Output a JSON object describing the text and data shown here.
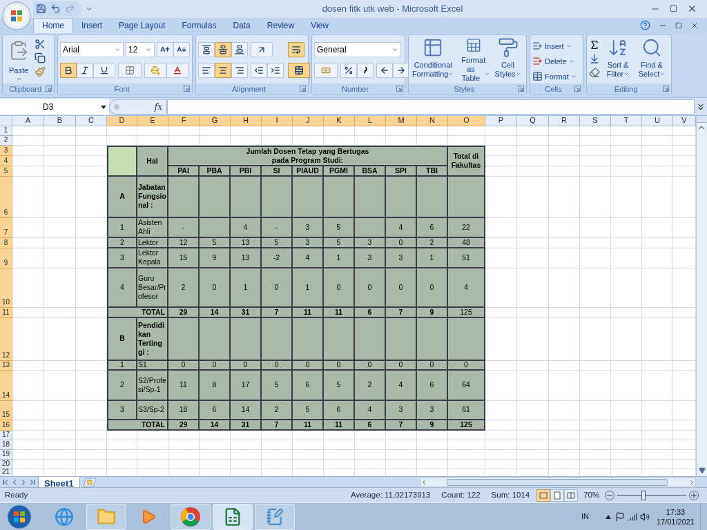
{
  "window": {
    "title": "dosen fitk utk web - Microsoft Excel"
  },
  "ribbon_tabs": [
    {
      "label": "Home",
      "selected": true
    },
    {
      "label": "Insert",
      "selected": false
    },
    {
      "label": "Page Layout",
      "selected": false
    },
    {
      "label": "Formulas",
      "selected": false
    },
    {
      "label": "Data",
      "selected": false
    },
    {
      "label": "Review",
      "selected": false
    },
    {
      "label": "View",
      "selected": false
    }
  ],
  "ribbon": {
    "clipboard": {
      "label": "Clipboard",
      "paste": "Paste"
    },
    "font": {
      "label": "Font",
      "name": "Arial",
      "size": "12",
      "bold": true,
      "italic": false,
      "underline": false
    },
    "alignment": {
      "label": "Alignment",
      "vertical": [
        {
          "kind": "top",
          "pressed": false
        },
        {
          "kind": "middle",
          "pressed": true
        },
        {
          "kind": "bottom",
          "pressed": false
        }
      ],
      "horizontal": [
        {
          "kind": "left",
          "pressed": false
        },
        {
          "kind": "center",
          "pressed": true
        },
        {
          "kind": "right",
          "pressed": false
        }
      ],
      "wrap_text": true,
      "merge": true
    },
    "number": {
      "label": "Number",
      "format": "General"
    },
    "styles": {
      "label": "Styles",
      "buttons": [
        {
          "kind": "conditional",
          "lines": [
            "Conditional",
            "Formatting"
          ]
        },
        {
          "kind": "table",
          "lines": [
            "Format",
            "as Table"
          ]
        },
        {
          "kind": "cell",
          "lines": [
            "Cell",
            "Styles"
          ]
        }
      ]
    },
    "cells": {
      "label": "Cells",
      "buttons": [
        {
          "kind": "insert",
          "label": "Insert"
        },
        {
          "kind": "delete",
          "label": "Delete"
        },
        {
          "kind": "format",
          "label": "Format"
        }
      ]
    },
    "editing": {
      "label": "Editing",
      "buttons": [
        {
          "kind": "sort",
          "lines": [
            "Sort &",
            "Filter"
          ]
        },
        {
          "kind": "find",
          "lines": [
            "Find &",
            "Select"
          ]
        }
      ]
    }
  },
  "formula_bar": {
    "name_box": "D3",
    "function_label": "fx"
  },
  "sheet": {
    "columns": [
      {
        "label": "A",
        "selected": false
      },
      {
        "label": "B",
        "selected": false
      },
      {
        "label": "C",
        "selected": false
      },
      {
        "label": "D",
        "selected": true
      },
      {
        "label": "E",
        "selected": true
      },
      {
        "label": "F",
        "selected": true
      },
      {
        "label": "G",
        "selected": true
      },
      {
        "label": "H",
        "selected": true
      },
      {
        "label": "I",
        "selected": true
      },
      {
        "label": "J",
        "selected": true
      },
      {
        "label": "K",
        "selected": true
      },
      {
        "label": "L",
        "selected": true
      },
      {
        "label": "M",
        "selected": true
      },
      {
        "label": "N",
        "selected": true
      },
      {
        "label": "O",
        "selected": true
      },
      {
        "label": "P",
        "selected": false
      },
      {
        "label": "Q",
        "selected": false
      },
      {
        "label": "R",
        "selected": false
      },
      {
        "label": "S",
        "selected": false
      },
      {
        "label": "T",
        "selected": false
      },
      {
        "label": "U",
        "selected": false
      },
      {
        "label": "V",
        "selected": false
      }
    ],
    "rows": [
      {
        "label": "1",
        "selected": false
      },
      {
        "label": "2",
        "selected": false
      },
      {
        "label": "3",
        "selected": true
      },
      {
        "label": "4",
        "selected": true
      },
      {
        "label": "5",
        "selected": true
      },
      {
        "label": "6",
        "selected": true
      },
      {
        "label": "7",
        "selected": true
      },
      {
        "label": "8",
        "selected": true
      },
      {
        "label": "9",
        "selected": true
      },
      {
        "label": "10",
        "selected": true
      },
      {
        "label": "11",
        "selected": true
      },
      {
        "label": "12",
        "selected": true
      },
      {
        "label": "13",
        "selected": true
      },
      {
        "label": "14",
        "selected": true
      },
      {
        "label": "15",
        "selected": true
      },
      {
        "label": "16",
        "selected": true
      },
      {
        "label": "17",
        "selected": false
      },
      {
        "label": "18",
        "selected": false
      },
      {
        "label": "19",
        "selected": false
      },
      {
        "label": "20",
        "selected": false
      },
      {
        "label": "21",
        "selected": false
      }
    ]
  },
  "table": {
    "hal_header": "Hal",
    "title_lines": [
      "Jumlah Dosen Tetap yang Bertugas",
      "pada Program Studi:"
    ],
    "total_header": "Total di Fakultas",
    "programs": [
      "PAI",
      "PBA",
      "PBI",
      "SI",
      "PIAUD",
      "PGMI",
      "BSA",
      "SPI",
      "TBI"
    ],
    "sections": [
      {
        "code": "A",
        "title": "Jabatan Fungsional :",
        "rows": [
          {
            "no": "1",
            "label": "Asisten Ahli",
            "values": [
              {
                "kind": "filled",
                "text": "-"
              },
              {
                "kind": "blank"
              },
              {
                "kind": "filled",
                "text": "4"
              },
              {
                "kind": "filled",
                "text": "-"
              },
              {
                "kind": "filled",
                "text": "3"
              },
              {
                "kind": "filled",
                "text": "5"
              },
              {
                "kind": "blank"
              },
              {
                "kind": "filled",
                "text": "4"
              },
              {
                "kind": "filled",
                "text": "6"
              }
            ],
            "total": "22"
          },
          {
            "no": "2",
            "label": "Lektor",
            "values": [
              {
                "text": "12"
              },
              {
                "text": "5"
              },
              {
                "text": "13"
              },
              {
                "text": "5"
              },
              {
                "text": "3"
              },
              {
                "text": "5"
              },
              {
                "text": "3"
              },
              {
                "text": "0"
              },
              {
                "text": "2"
              }
            ],
            "total": "48"
          },
          {
            "no": "3",
            "label": "Lektor Kepala",
            "values": [
              {
                "text": "15"
              },
              {
                "text": "9"
              },
              {
                "text": "13"
              },
              {
                "text": "-2"
              },
              {
                "text": "4"
              },
              {
                "text": "1"
              },
              {
                "text": "3"
              },
              {
                "text": "3"
              },
              {
                "text": "1"
              }
            ],
            "total": "51"
          },
          {
            "no": "4",
            "label": "Guru Besar/Profesor",
            "values": [
              {
                "text": "2"
              },
              {
                "text": "0"
              },
              {
                "text": "1"
              },
              {
                "text": "0"
              },
              {
                "text": "1"
              },
              {
                "text": "0"
              },
              {
                "text": "0"
              },
              {
                "text": "0"
              },
              {
                "text": "0"
              }
            ],
            "total": "4"
          }
        ],
        "total_row": {
          "label": "TOTAL",
          "values": [
            {
              "text": "29"
            },
            {
              "text": "14"
            },
            {
              "text": "31"
            },
            {
              "text": "7"
            },
            {
              "text": "11"
            },
            {
              "text": "11"
            },
            {
              "text": "6"
            },
            {
              "text": "7"
            },
            {
              "text": "9"
            }
          ],
          "total": "125",
          "total_bold": false
        }
      },
      {
        "code": "B",
        "title": "Pendidikan Tertinggi :",
        "rows": [
          {
            "no": "1",
            "label": "S1",
            "values": [
              {
                "text": "0"
              },
              {
                "text": "0"
              },
              {
                "text": "0"
              },
              {
                "text": "0"
              },
              {
                "text": "0"
              },
              {
                "text": "0"
              },
              {
                "text": "0"
              },
              {
                "text": "0"
              },
              {
                "text": "0"
              }
            ],
            "total": "0"
          },
          {
            "no": "2",
            "label": "S2/Profesi/Sp-1",
            "values": [
              {
                "text": "11"
              },
              {
                "text": "8"
              },
              {
                "text": "17"
              },
              {
                "text": "5"
              },
              {
                "text": "6"
              },
              {
                "text": "5"
              },
              {
                "text": "2"
              },
              {
                "text": "4"
              },
              {
                "text": "6"
              }
            ],
            "total": "64"
          },
          {
            "no": "3",
            "label": "S3/Sp-2",
            "values": [
              {
                "text": "18"
              },
              {
                "text": "6"
              },
              {
                "text": "14"
              },
              {
                "text": "2"
              },
              {
                "text": "5"
              },
              {
                "text": "6"
              },
              {
                "text": "4"
              },
              {
                "text": "3"
              },
              {
                "text": "3"
              }
            ],
            "total": "61"
          }
        ],
        "total_row": {
          "label": "TOTAL",
          "values": [
            {
              "text": "29"
            },
            {
              "text": "14"
            },
            {
              "text": "31"
            },
            {
              "text": "7"
            },
            {
              "text": "11"
            },
            {
              "text": "11"
            },
            {
              "text": "6"
            },
            {
              "text": "7"
            },
            {
              "text": "9"
            }
          ],
          "total": "125",
          "total_bold": true
        }
      }
    ]
  },
  "sheet_tabs": [
    {
      "label": "Sheet1",
      "selected": true
    }
  ],
  "status_bar": {
    "mode": "Ready",
    "average": "Average: 11,02173913",
    "count": "Count: 122",
    "sum": "Sum: 1014",
    "views": [
      {
        "kind": "normal",
        "selected": true
      },
      {
        "kind": "page_layout",
        "selected": false
      },
      {
        "kind": "page_break",
        "selected": false
      }
    ],
    "zoom": "70%",
    "zoom_slider": {
      "level": 0.38
    }
  },
  "taskbar": {
    "apps": [
      {
        "kind": "browser",
        "running": false,
        "active": false
      },
      {
        "kind": "folder",
        "running": true,
        "active": false
      },
      {
        "kind": "media",
        "running": false,
        "active": false
      },
      {
        "kind": "chrome",
        "running": true,
        "active": false
      },
      {
        "kind": "excel",
        "running": true,
        "active": true
      },
      {
        "kind": "notepad",
        "running": true,
        "active": false
      }
    ],
    "language": "IN",
    "time": "17:33",
    "date": "17/01/2021"
  }
}
